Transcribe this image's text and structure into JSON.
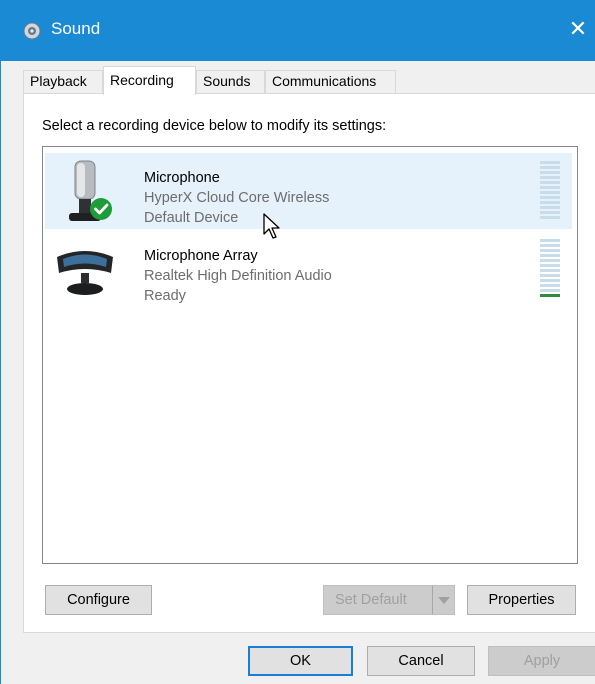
{
  "window": {
    "title": "Sound",
    "close_glyph": "✕",
    "app_icon": "speaker-icon"
  },
  "tabs": [
    {
      "label": "Playback"
    },
    {
      "label": "Recording",
      "active": true
    },
    {
      "label": "Sounds"
    },
    {
      "label": "Communications"
    }
  ],
  "instruction": "Select a recording device below to modify its settings:",
  "devices": [
    {
      "name": "Microphone",
      "description": "HyperX Cloud Core Wireless",
      "status": "Default Device",
      "icon": "microphone-icon",
      "badge": "default-check-icon",
      "selected": true,
      "level": 0
    },
    {
      "name": "Microphone Array",
      "description": "Realtek High Definition Audio",
      "status": "Ready",
      "icon": "microphone-array-icon",
      "selected": false,
      "level": 0.1
    }
  ],
  "buttons": {
    "configure": "Configure",
    "set_default": "Set Default",
    "properties": "Properties",
    "ok": "OK",
    "cancel": "Cancel",
    "apply": "Apply"
  },
  "colors": {
    "accent": "#1a8ad4",
    "selection": "#e5f1fb",
    "meter_on": "#2e8b3f",
    "meter_off": "#c8dde9"
  }
}
